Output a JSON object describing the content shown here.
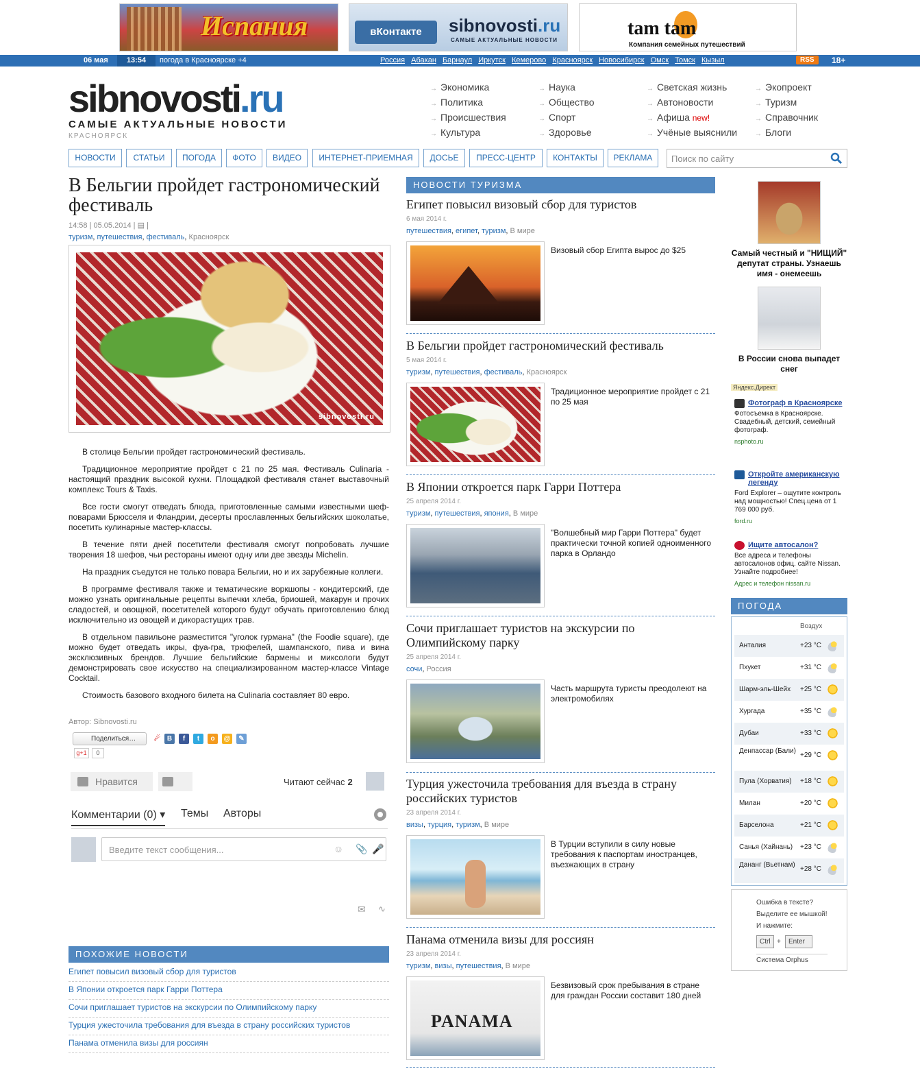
{
  "banners": {
    "spain": "Испания",
    "vk_button": "вКонтакте",
    "vk_site": "sibnovosti",
    "vk_site_tld": ".ru",
    "vk_slogan": "САМЫЕ АКТУАЛЬНЫЕ НОВОСТИ",
    "tamtam": "tam tam",
    "tamtam_slogan": "Компания семейных путешествий"
  },
  "topbar": {
    "date": "06 мая",
    "time": "13:54",
    "weather": "погода в Красноярске +4",
    "cities": [
      "Россия",
      "Абакан",
      "Барнаул",
      "Иркутск",
      "Кемерово",
      "Красноярск",
      "Новосибирск",
      "Омск",
      "Томск",
      "Кызыл"
    ],
    "rss": "RSS",
    "age": "18+"
  },
  "logo": {
    "name": "sibnovosti",
    "tld": ".ru",
    "slogan": "САМЫЕ АКТУАЛЬНЫЕ НОВОСТИ",
    "city": "КРАСНОЯРСК"
  },
  "categories": [
    [
      "Экономика",
      "Политика",
      "Происшествия",
      "Культура"
    ],
    [
      "Наука",
      "Общество",
      "Спорт",
      "Здоровье"
    ],
    [
      "Светская жизнь",
      "Автоновости",
      "Афиша",
      "Учёные выяснили"
    ],
    [
      "Экопроект",
      "Туризм",
      "Справочник",
      "Блоги"
    ]
  ],
  "afisha_new": "new!",
  "mainnav": [
    "НОВОСТИ",
    "СТАТЬИ",
    "ПОГОДА",
    "ФОТО",
    "ВИДЕО",
    "ИНТЕРНЕТ-ПРИЕМНАЯ",
    "ДОСЬЕ",
    "ПРЕСС-ЦЕНТР",
    "КОНТАКТЫ",
    "РЕКЛАМА"
  ],
  "search": {
    "placeholder": "Поиск по сайту"
  },
  "article": {
    "title": "В Бельгии пройдет гастрономический фестиваль",
    "time": "14:58",
    "date": "05.05.2014",
    "tags": [
      "туризм",
      "путешествия",
      "фестиваль"
    ],
    "place": "Красноярск",
    "watermark": "sibnovosti.ru",
    "paragraphs": [
      "В столице Бельгии пройдет гастрономический фестиваль.",
      "Традиционное мероприятие пройдет с 21 по 25 мая. Фестиваль Culinaria - настоящий праздник высокой кухни. Площадкой фестиваля станет выставочный комплекс Tours & Taxis.",
      "Все гости смогут отведать блюда, приготовленные самыми известными шеф-поварами Брюсселя и Фландрии, десерты прославленных бельгийских шоколатье, посетить кулинарные мастер-классы.",
      "В течение пяти дней посетители фестиваля смогут попробовать лучшие творения 18 шефов, чьи рестораны имеют одну или две звезды Michelin.",
      "На праздник съедутся не только повара Бельгии, но и их зарубежные коллеги.",
      "В программе фестиваля также и тематические воркшопы - кондитерский, где можно узнать оригинальные рецепты выпечки хлеба, бриошей, макарун и прочих сладостей, и овощной, посетителей которого будут обучать приготовлению блюд исключительно из овощей и дикорастущих трав.",
      "В отдельном павильоне разместится \"уголок гурмана\" (the Foodie square), где можно будет отведать икры, фуа-гра, трюфелей, шампанского, пива и вина эксклюзивных брендов. Лучшие бельгийские бармены и миксологи будут демонстрировать свое искусство на специализированном мастер-классе Vintage Cocktail.",
      "Стоимость базового входного билета на Culinaria составляет 80 евро."
    ],
    "author": "Автор: Sibnovosti.ru",
    "share_label": "Поделиться…",
    "gplus": "g+1",
    "gplus_count": "0"
  },
  "comments": {
    "like": "Нравится",
    "reading_now": "Читают сейчас",
    "reading_count": "2",
    "tab_comments": "Комментарии (0)",
    "tab_topics": "Темы",
    "tab_authors": "Авторы",
    "placeholder": "Введите текст сообщения..."
  },
  "similar": {
    "header": "ПОХОЖИЕ НОВОСТИ",
    "items": [
      "Египет повысил визовый сбор для туристов",
      "В Японии откроется парк Гарри Поттера",
      "Сочи приглашает туристов на экскурсии по Олимпийскому парку",
      "Турция ужесточила требования для въезда в страну российских туристов",
      "Панама отменила визы для россиян"
    ]
  },
  "tourism": {
    "header": "НОВОСТИ ТУРИЗМА",
    "items": [
      {
        "title": "Египет повысил визовый сбор для туристов",
        "date": "6 мая 2014 г.",
        "tags": [
          "путешествия",
          "египет",
          "туризм"
        ],
        "place": "В мире",
        "text": "Визовый сбор Египта вырос до $25"
      },
      {
        "title": "В Бельгии пройдет гастрономический фестиваль",
        "date": "5 мая 2014 г.",
        "tags": [
          "туризм",
          "путешествия",
          "фестиваль"
        ],
        "place": "Красноярск",
        "text": "Традиционное мероприятие пройдет с 21 по 25 мая"
      },
      {
        "title": "В Японии откроется парк Гарри Поттера",
        "date": "25 апреля 2014 г.",
        "tags": [
          "туризм",
          "путешествия",
          "япония"
        ],
        "place": "В мире",
        "text": "\"Волшебный мир Гарри Поттера\" будет практически точной копией одноименного парка в Орландо"
      },
      {
        "title": "Сочи приглашает туристов на экскурсии по Олимпийскому парку",
        "date": "25 апреля 2014 г.",
        "tags": [
          "сочи"
        ],
        "place": "Россия",
        "text": "Часть маршрута туристы преодолеют на электромобилях"
      },
      {
        "title": "Турция ужесточила требования для въезда в страну российских туристов",
        "date": "23 апреля 2014 г.",
        "tags": [
          "визы",
          "турция",
          "туризм"
        ],
        "place": "В мире",
        "text": "В Турции вступили в силу новые требования к паспортам иностранцев, въезжающих в страну"
      },
      {
        "title": "Панама отменила визы для россиян",
        "date": "23 апреля 2014 г.",
        "tags": [
          "туризм",
          "визы",
          "путешествия"
        ],
        "place": "В мире",
        "text": "Безвизовый срок пребывания в стране для граждан России составит 180 дней"
      }
    ],
    "panama_sign": "PANAMA"
  },
  "promos": [
    "Самый честный и \"НИЩИЙ\" депутат страны. Узнаешь имя - онемеешь",
    "В России снова выпадет снег"
  ],
  "yandex_direct": "Яндекс.Директ",
  "ads": [
    {
      "title": "Фотограф в Красноярске",
      "body": "Фотосъемка в Красноярске. Свадебный, детский, семейный фотограф.",
      "domain": "nsphoto.ru"
    },
    {
      "title": "Откройте американскую легенду",
      "body": "Ford Explorer – ощутите контроль над мощностью! Спец.цена от 1 769 000 руб.",
      "domain": "ford.ru"
    },
    {
      "title": "Ищите автосалон?",
      "body": "Все адреса и телефоны автосалонов офиц. сайте Nissan. Узнайте подробнее!",
      "domain": "Адрес и телефон nissan.ru"
    }
  ],
  "weather": {
    "header": "ПОГОДА",
    "col": "Воздух",
    "rows": [
      {
        "city": "Анталия",
        "temp": "+23 °C",
        "icon": "cloud-sun-icon"
      },
      {
        "city": "Пхукет",
        "temp": "+31 °C",
        "icon": "cloud-sun-icon"
      },
      {
        "city": "Шарм-эль-Шейх",
        "temp": "+25 °C",
        "icon": "sun-icon"
      },
      {
        "city": "Хургада",
        "temp": "+35 °C",
        "icon": "cloud-sun-icon"
      },
      {
        "city": "Дубаи",
        "temp": "+33 °C",
        "icon": "sun-icon"
      },
      {
        "city": "Денпассар (Бали)",
        "temp": "+29 °C",
        "icon": "sun-icon"
      },
      {
        "city": "Пула (Хорватия)",
        "temp": "+18 °C",
        "icon": "sun-icon"
      },
      {
        "city": "Милан",
        "temp": "+20 °C",
        "icon": "sun-icon"
      },
      {
        "city": "Барселона",
        "temp": "+21 °C",
        "icon": "sun-icon"
      },
      {
        "city": "Санья (Хайнань)",
        "temp": "+23 °C",
        "icon": "cloud-sun-icon"
      },
      {
        "city": "Дананг (Вьетнам)",
        "temp": "+28 °C",
        "icon": "cloud-sun-icon"
      }
    ]
  },
  "orphus": {
    "l1": "Ошибка в тексте?",
    "l2": "Выделите ее мышкой!",
    "l3": "И нажмите:",
    "ctrl": "Ctrl",
    "plus": "+",
    "enter": "Enter",
    "system": "Система Orphus"
  }
}
